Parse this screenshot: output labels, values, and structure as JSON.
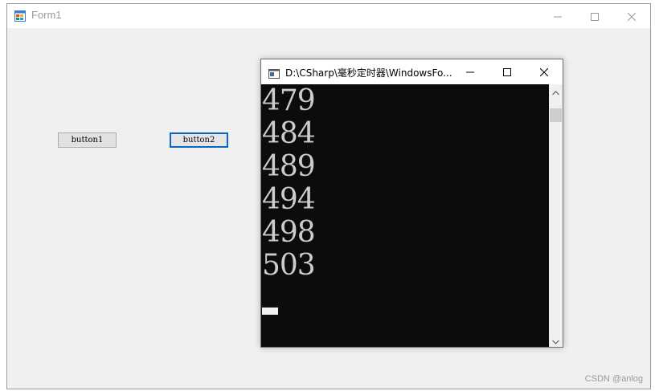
{
  "form": {
    "title": "Form1",
    "icon": "winforms-app-icon",
    "button1_label": "button1",
    "button2_label": "button2"
  },
  "console": {
    "title": "D:\\CSharp\\毫秒定时器\\WindowsFo...",
    "icon": "console-app-icon",
    "lines": [
      "479",
      "484",
      "489",
      "494",
      "498",
      "503"
    ],
    "text_color": "#cccccc",
    "background_color": "#0c0c0c"
  },
  "focus_color": "#0a66c2",
  "watermark": "CSDN @anlog"
}
